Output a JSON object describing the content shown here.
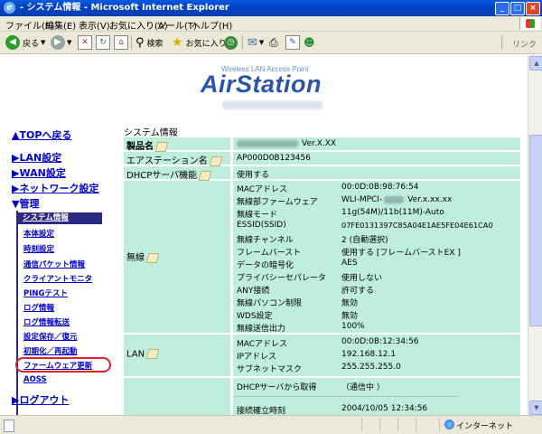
{
  "window": {
    "title": "- システム情報 - Microsoft Internet Explorer",
    "min": "_",
    "max": "□",
    "close": "×"
  },
  "menu": [
    "ファイル(F)",
    "編集(E)",
    "表示(V)",
    "お気に入り(A)",
    "ツール(T)",
    "ヘルプ(H)"
  ],
  "toolbar": {
    "back": "戻る",
    "search": "検索",
    "favorites": "お気に入り",
    "links": "リンク",
    "icons": [
      "back-arrow-icon",
      "forward-arrow-icon",
      "stop-icon",
      "refresh-icon",
      "home-icon",
      "search-icon",
      "favorites-star-icon",
      "history-icon",
      "mail-icon",
      "print-icon",
      "edit-icon",
      "messenger-icon"
    ]
  },
  "logo": {
    "sub": "Wireless LAN Access Point",
    "main": "AirStation"
  },
  "nav": {
    "top": "▲TOPへ戻る",
    "lan": "▶LAN設定",
    "wan": "▶WAN設定",
    "network": "▶ネットワーク設定",
    "admin": "▼管理",
    "admin_items": [
      "システム情報",
      "本体設定",
      "時刻設定",
      "通信パケット情報",
      "クライアントモニタ",
      "PINGテスト",
      "ログ情報",
      "ログ情報転送",
      "設定保存／復元",
      "初期化／再起動",
      "ファームウェア更新",
      "AOSS"
    ],
    "logout": "▶ログアウト"
  },
  "system_info": {
    "heading": "システム情報",
    "product_label": "製品名",
    "product_value": "Ver.X.XX",
    "essid_label": "エアステーション名",
    "essid_value": "AP000D0B123456",
    "dhcp_func_label": "DHCPサーバ機能",
    "dhcp_func_value": "使用する",
    "wireless_label": "無線",
    "wireless": [
      {
        "k": "MACアドレス",
        "v": "00:0D:0B:98:76:54"
      },
      {
        "k": "無線部ファームウェア",
        "v": "WLI-MPCI-",
        "v2": "Ver.x.xx.xx"
      },
      {
        "k": "無線モード",
        "v": "11g(54M)/11b(11M)-Auto"
      },
      {
        "k": "ESSID(SSID)",
        "v": "07FE0131397C85A04E1AE5FE04E61CA0"
      },
      {
        "k": "無線チャンネル",
        "v": "2 (自動選択)"
      },
      {
        "k": "フレームバースト",
        "v": "使用する [フレームバーストEX ]"
      },
      {
        "k": "データの暗号化",
        "v": "AES"
      },
      {
        "k": "プライバシーセパレータ",
        "v": "使用しない"
      },
      {
        "k": "ANY接続",
        "v": "許可する"
      },
      {
        "k": "無線パソコン制限",
        "v": "無効"
      },
      {
        "k": "WDS設定",
        "v": "無効"
      },
      {
        "k": "無線送信出力",
        "v": "100%"
      }
    ],
    "lan_label": "LAN",
    "lan": [
      {
        "k": "MACアドレス",
        "v": "00:0D:0B:12:34:56"
      },
      {
        "k": "IPアドレス",
        "v": "192.168.12.1"
      },
      {
        "k": "サブネットマスク",
        "v": "255.255.255.0"
      }
    ],
    "dhcp_get_label": "DHCPサーバから取得",
    "dhcp_get_value": "（通信中 ）",
    "conn_time_label": "接続確立時刻",
    "conn_time_value": "2004/10/05 12:34:56"
  },
  "statusbar": {
    "zone": "インターネット"
  }
}
